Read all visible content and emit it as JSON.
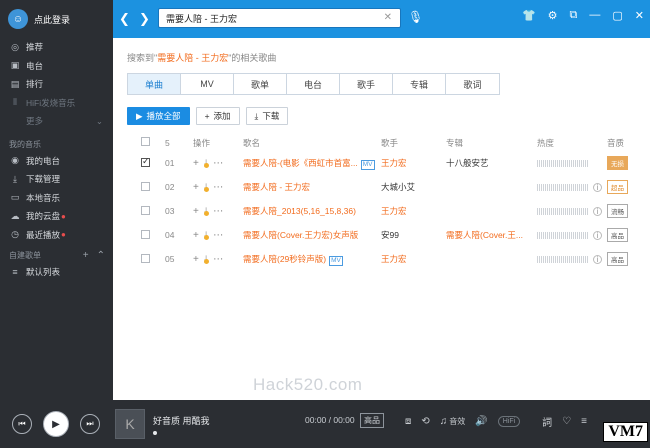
{
  "sidebar": {
    "login": "点此登录",
    "nav": [
      {
        "label": "推荐",
        "icon": "disc-icon"
      },
      {
        "label": "电台",
        "icon": "radio-icon"
      },
      {
        "label": "排行",
        "icon": "chart-icon"
      },
      {
        "label": "HiFi发烧音乐",
        "icon": "hifi-icon"
      }
    ],
    "more": "更多",
    "my_music_title": "我的音乐",
    "my_music": [
      {
        "label": "我的电台",
        "icon": "radio-icon"
      },
      {
        "label": "下载管理",
        "icon": "download-icon"
      },
      {
        "label": "本地音乐",
        "icon": "monitor-icon"
      },
      {
        "label": "我的云盘",
        "icon": "cloud-icon"
      },
      {
        "label": "最近播放",
        "icon": "clock-icon"
      }
    ],
    "playlist_title": "自建歌单",
    "playlist_default": "默认列表"
  },
  "topbar": {
    "search_value": "需要人陪 - 王力宏"
  },
  "main": {
    "hint_prefix": "搜索到\"",
    "hint_query": "需要人陪 - 王力宏",
    "hint_suffix": "\"的相关歌曲",
    "tabs": [
      "单曲",
      "MV",
      "歌单",
      "电台",
      "歌手",
      "专辑",
      "歌词"
    ],
    "play_all": "播放全部",
    "add": "添加",
    "download": "下载",
    "headers": {
      "count": "5",
      "ops": "操作",
      "name": "歌名",
      "singer": "歌手",
      "album": "专辑",
      "heat": "热度",
      "quality": "音质"
    },
    "rows": [
      {
        "num": "01",
        "name": "需要人陪-(电影《西虹市首富...",
        "mv": "MV",
        "singer": "王力宏",
        "album": "十八般安艺",
        "quality": "无损",
        "checked": true
      },
      {
        "num": "02",
        "name": "需要人陪 - 王力宏",
        "mv": "",
        "singer": "大城小艾",
        "album": "",
        "quality": "超品",
        "checked": false
      },
      {
        "num": "03",
        "name": "需要人陪_2013(5,16_15,8,36)",
        "mv": "",
        "singer": "王力宏",
        "album": "",
        "quality": "流畅",
        "checked": false
      },
      {
        "num": "04",
        "name": "需要人陪(Cover.王力宏)女声版",
        "mv": "",
        "singer": "安99",
        "album": "需要人陪(Cover.王...",
        "quality": "高品",
        "checked": false
      },
      {
        "num": "05",
        "name": "需要人陪(29秒铃声版)",
        "mv": "MV",
        "singer": "王力宏",
        "album": "",
        "quality": "高品",
        "checked": false
      }
    ],
    "watermark": "Hack520.com"
  },
  "player": {
    "title": "好音质 用酷我",
    "time": "00:00 / 00:00",
    "quality": "高品",
    "effect": "音效",
    "hifi": "HiFi",
    "badge": "VM7"
  }
}
